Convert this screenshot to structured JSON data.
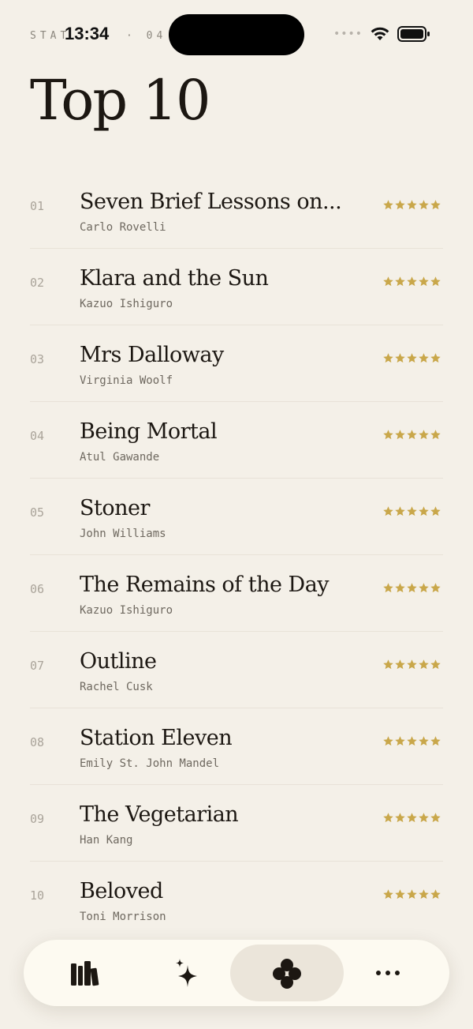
{
  "status_bar": {
    "prefix": "STAT",
    "time": "13:34",
    "suffix": "· 04"
  },
  "page": {
    "title": "Top 10"
  },
  "books": [
    {
      "rank": "01",
      "title": "Seven Brief Lessons on...",
      "author": "Carlo Rovelli",
      "rating": 5
    },
    {
      "rank": "02",
      "title": "Klara and the Sun",
      "author": "Kazuo Ishiguro",
      "rating": 5
    },
    {
      "rank": "03",
      "title": "Mrs Dalloway",
      "author": "Virginia Woolf",
      "rating": 5
    },
    {
      "rank": "04",
      "title": "Being Mortal",
      "author": "Atul Gawande",
      "rating": 5
    },
    {
      "rank": "05",
      "title": "Stoner",
      "author": "John Williams",
      "rating": 5
    },
    {
      "rank": "06",
      "title": "The Remains of the Day",
      "author": "Kazuo Ishiguro",
      "rating": 5
    },
    {
      "rank": "07",
      "title": "Outline",
      "author": "Rachel Cusk",
      "rating": 5
    },
    {
      "rank": "08",
      "title": "Station Eleven",
      "author": "Emily St. John Mandel",
      "rating": 5
    },
    {
      "rank": "09",
      "title": "The Vegetarian",
      "author": "Han Kang",
      "rating": 5
    },
    {
      "rank": "10",
      "title": "Beloved",
      "author": "Toni Morrison",
      "rating": 5
    }
  ],
  "tabs": [
    {
      "icon": "library-icon",
      "active": false
    },
    {
      "icon": "sparkle-icon",
      "active": false
    },
    {
      "icon": "clover-icon",
      "active": true
    },
    {
      "icon": "more-icon",
      "active": false
    }
  ],
  "colors": {
    "background": "#f4f0e8",
    "star": "#c9a74a",
    "text": "#1c1712",
    "tab_bar": "#fdfaf1",
    "tab_active": "#ebe5da"
  }
}
